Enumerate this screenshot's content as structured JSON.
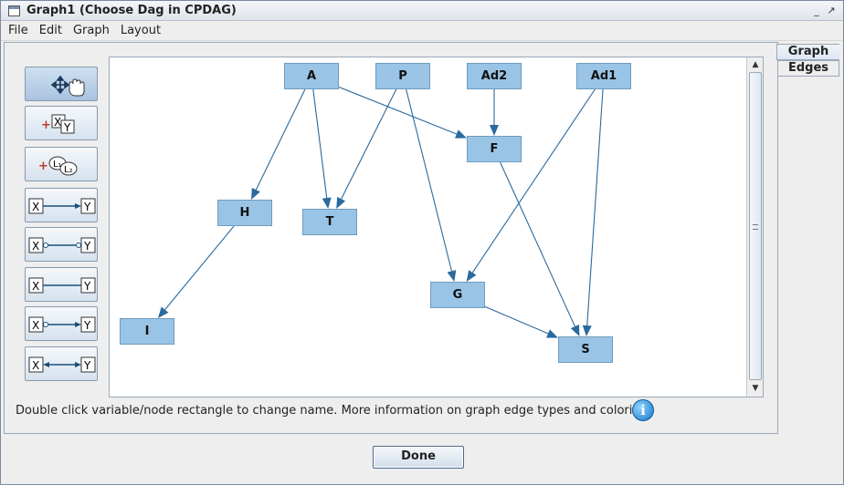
{
  "window": {
    "title": "Graph1 (Choose Dag in CPDAG)"
  },
  "menu": [
    "File",
    "Edit",
    "Graph",
    "Layout"
  ],
  "tabs": [
    {
      "label": "Graph",
      "active": true
    },
    {
      "label": "Edges",
      "active": false
    }
  ],
  "toolbar": {
    "tools": [
      {
        "name": "select-move-tool",
        "selected": true
      },
      {
        "name": "add-measured-variable-tool"
      },
      {
        "name": "add-latent-variable-tool"
      },
      {
        "name": "directed-edge-tool"
      },
      {
        "name": "nondirected-edge-tool"
      },
      {
        "name": "undirected-edge-tool"
      },
      {
        "name": "partially-oriented-edge-tool"
      },
      {
        "name": "bidirected-edge-tool"
      }
    ],
    "labels": {
      "x": "X",
      "y": "Y",
      "l1": "L₁",
      "l2": "L₂"
    }
  },
  "graph": {
    "nodes": [
      "A",
      "P",
      "Ad2",
      "Ad1",
      "F",
      "H",
      "T",
      "G",
      "I",
      "S"
    ],
    "edges": [
      [
        "A",
        "H"
      ],
      [
        "A",
        "T"
      ],
      [
        "A",
        "F"
      ],
      [
        "P",
        "T"
      ],
      [
        "P",
        "G"
      ],
      [
        "Ad2",
        "F"
      ],
      [
        "Ad1",
        "G"
      ],
      [
        "Ad1",
        "S"
      ],
      [
        "F",
        "S"
      ],
      [
        "H",
        "I"
      ],
      [
        "G",
        "S"
      ]
    ]
  },
  "info": {
    "text": "Double click variable/node rectangle to change name. More information on graph edge types and colorings"
  },
  "buttons": {
    "done": "Done"
  },
  "colors": {
    "node_fill": "#99c4e6",
    "edge": "#2a6a9e",
    "tool_accent": "#c0392b"
  }
}
